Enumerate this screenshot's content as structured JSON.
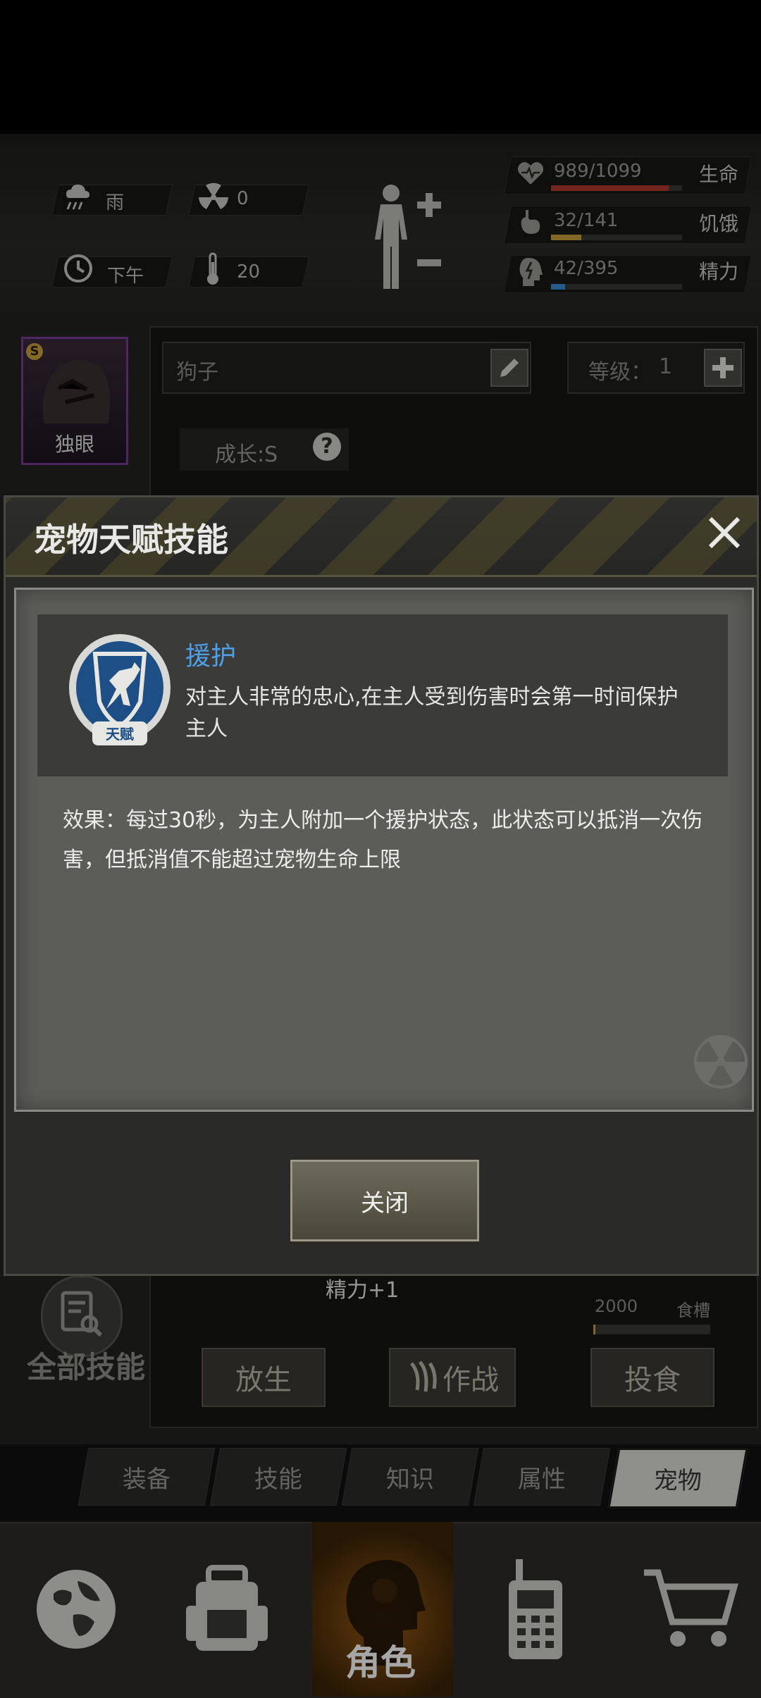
{
  "status": {
    "weather": "雨",
    "radiation": "0",
    "time_of_day": "下午",
    "temperature": "20"
  },
  "bars": [
    {
      "value": "989/1099",
      "label": "生命",
      "fraction": 0.9,
      "color": "#b23a2e"
    },
    {
      "value": "32/141",
      "label": "饥饿",
      "fraction": 0.23,
      "color": "#c9a23a"
    },
    {
      "value": "42/395",
      "label": "精力",
      "fraction": 0.11,
      "color": "#3b8ad6"
    }
  ],
  "pet": {
    "portrait_name": "独眼",
    "rank_badge": "S",
    "name": "狗子",
    "level_label": "等级：",
    "level_value": "1",
    "growth": "成长:S",
    "stamina_bonus": "精力+1",
    "food_capacity": "2000",
    "food_label": "食槽",
    "all_skills_label": "全部技能",
    "release_label": "放生",
    "battle_label": "作战",
    "feed_label": "投食"
  },
  "modal": {
    "title": "宠物天赋技能",
    "skill_name": "援护",
    "skill_badge": "天赋",
    "skill_desc": "对主人非常的忠心,在主人受到伤害时会第一时间保护主人",
    "effect": "效果：每过30秒，为主人附加一个援护状态，此状态可以抵消一次伤害，但抵消值不能超过宠物生命上限",
    "close_label": "关闭"
  },
  "subtabs": [
    "装备",
    "技能",
    "知识",
    "属性",
    "宠物"
  ],
  "subtab_active": "宠物",
  "nav": {
    "role_label": "角色",
    "items": [
      "globe-icon",
      "backpack-icon",
      "role-icon",
      "radio-icon",
      "cart-icon"
    ]
  },
  "colors": {
    "accent_blue": "#4e9fe8",
    "nav_active": "#9a5b14"
  }
}
